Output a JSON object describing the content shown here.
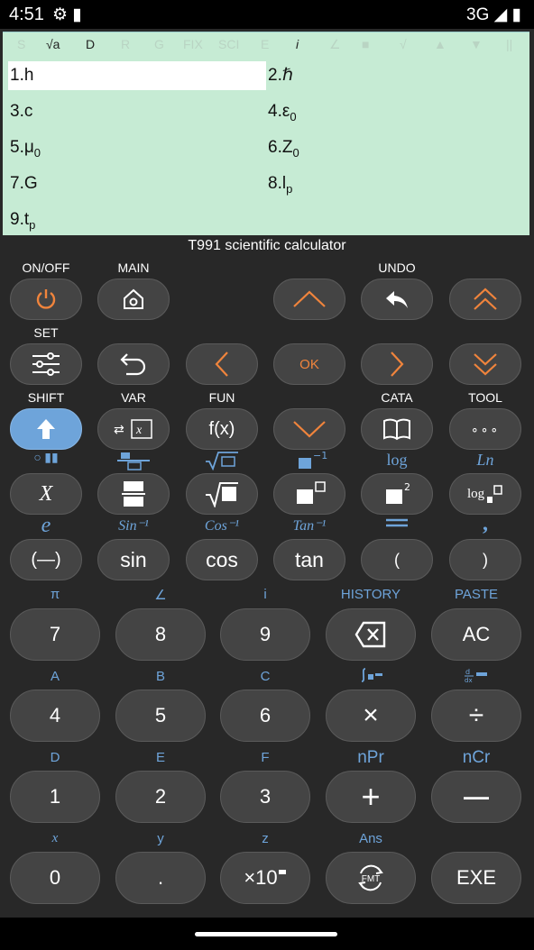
{
  "status": {
    "time": "4:51",
    "network": "3G"
  },
  "display": {
    "indicators": [
      "S",
      "√a",
      "D",
      "R",
      "G",
      "FIX",
      "SCI",
      "E",
      "i",
      "∠",
      "■",
      "√",
      "▲",
      "▼",
      "||"
    ],
    "constants": [
      {
        "text": "1.h",
        "sub": ""
      },
      {
        "text": "2.ℏ",
        "sub": ""
      },
      {
        "text": "3.c",
        "sub": ""
      },
      {
        "text": "4.ε",
        "sub": "0"
      },
      {
        "text": "5.μ",
        "sub": "0"
      },
      {
        "text": "6.Z",
        "sub": "0"
      },
      {
        "text": "7.G",
        "sub": ""
      },
      {
        "text": "8.l",
        "sub": "p"
      },
      {
        "text": "9.t",
        "sub": "p"
      }
    ]
  },
  "title": "T991 scientific calculator",
  "top_labels": {
    "onoff": "ON/OFF",
    "main": "MAIN",
    "undo": "UNDO",
    "set": "SET",
    "shift": "SHIFT",
    "var": "VAR",
    "fun": "FUN",
    "cata": "CATA",
    "tool": "TOOL"
  },
  "keys": {
    "ok": "OK",
    "fx": "f(x)",
    "tool": "∘∘∘",
    "sin": "sin",
    "cos": "cos",
    "tan": "tan",
    "neg": "(—)",
    "lparen": "(",
    "rparen": ")",
    "x_var": "X"
  },
  "alt_labels": {
    "log": "log",
    "ln": "Ln",
    "e": "e",
    "asin": "Sin⁻¹",
    "acos": "Cos⁻¹",
    "atan": "Tan⁻¹",
    "comma": ","
  },
  "numpad": {
    "row1": {
      "labels": [
        "π",
        "∠",
        "i",
        "HISTORY",
        "PASTE"
      ],
      "keys": [
        "7",
        "8",
        "9",
        "",
        "AC"
      ]
    },
    "row2": {
      "labels": [
        "A",
        "B",
        "C",
        "",
        ""
      ],
      "keys": [
        "4",
        "5",
        "6",
        "×",
        "÷"
      ]
    },
    "row3": {
      "labels": [
        "D",
        "E",
        "F",
        "nPr",
        "nCr"
      ],
      "keys": [
        "1",
        "2",
        "3",
        "+",
        "—"
      ]
    },
    "row4": {
      "labels": [
        "x",
        "y",
        "z",
        "Ans",
        ""
      ],
      "keys": [
        "0",
        ".",
        "×10",
        "FMT",
        "EXE"
      ]
    }
  },
  "colors": {
    "accent_orange": "#f0843c",
    "accent_blue": "#6ea4da",
    "display_bg": "#c6ebd4"
  }
}
